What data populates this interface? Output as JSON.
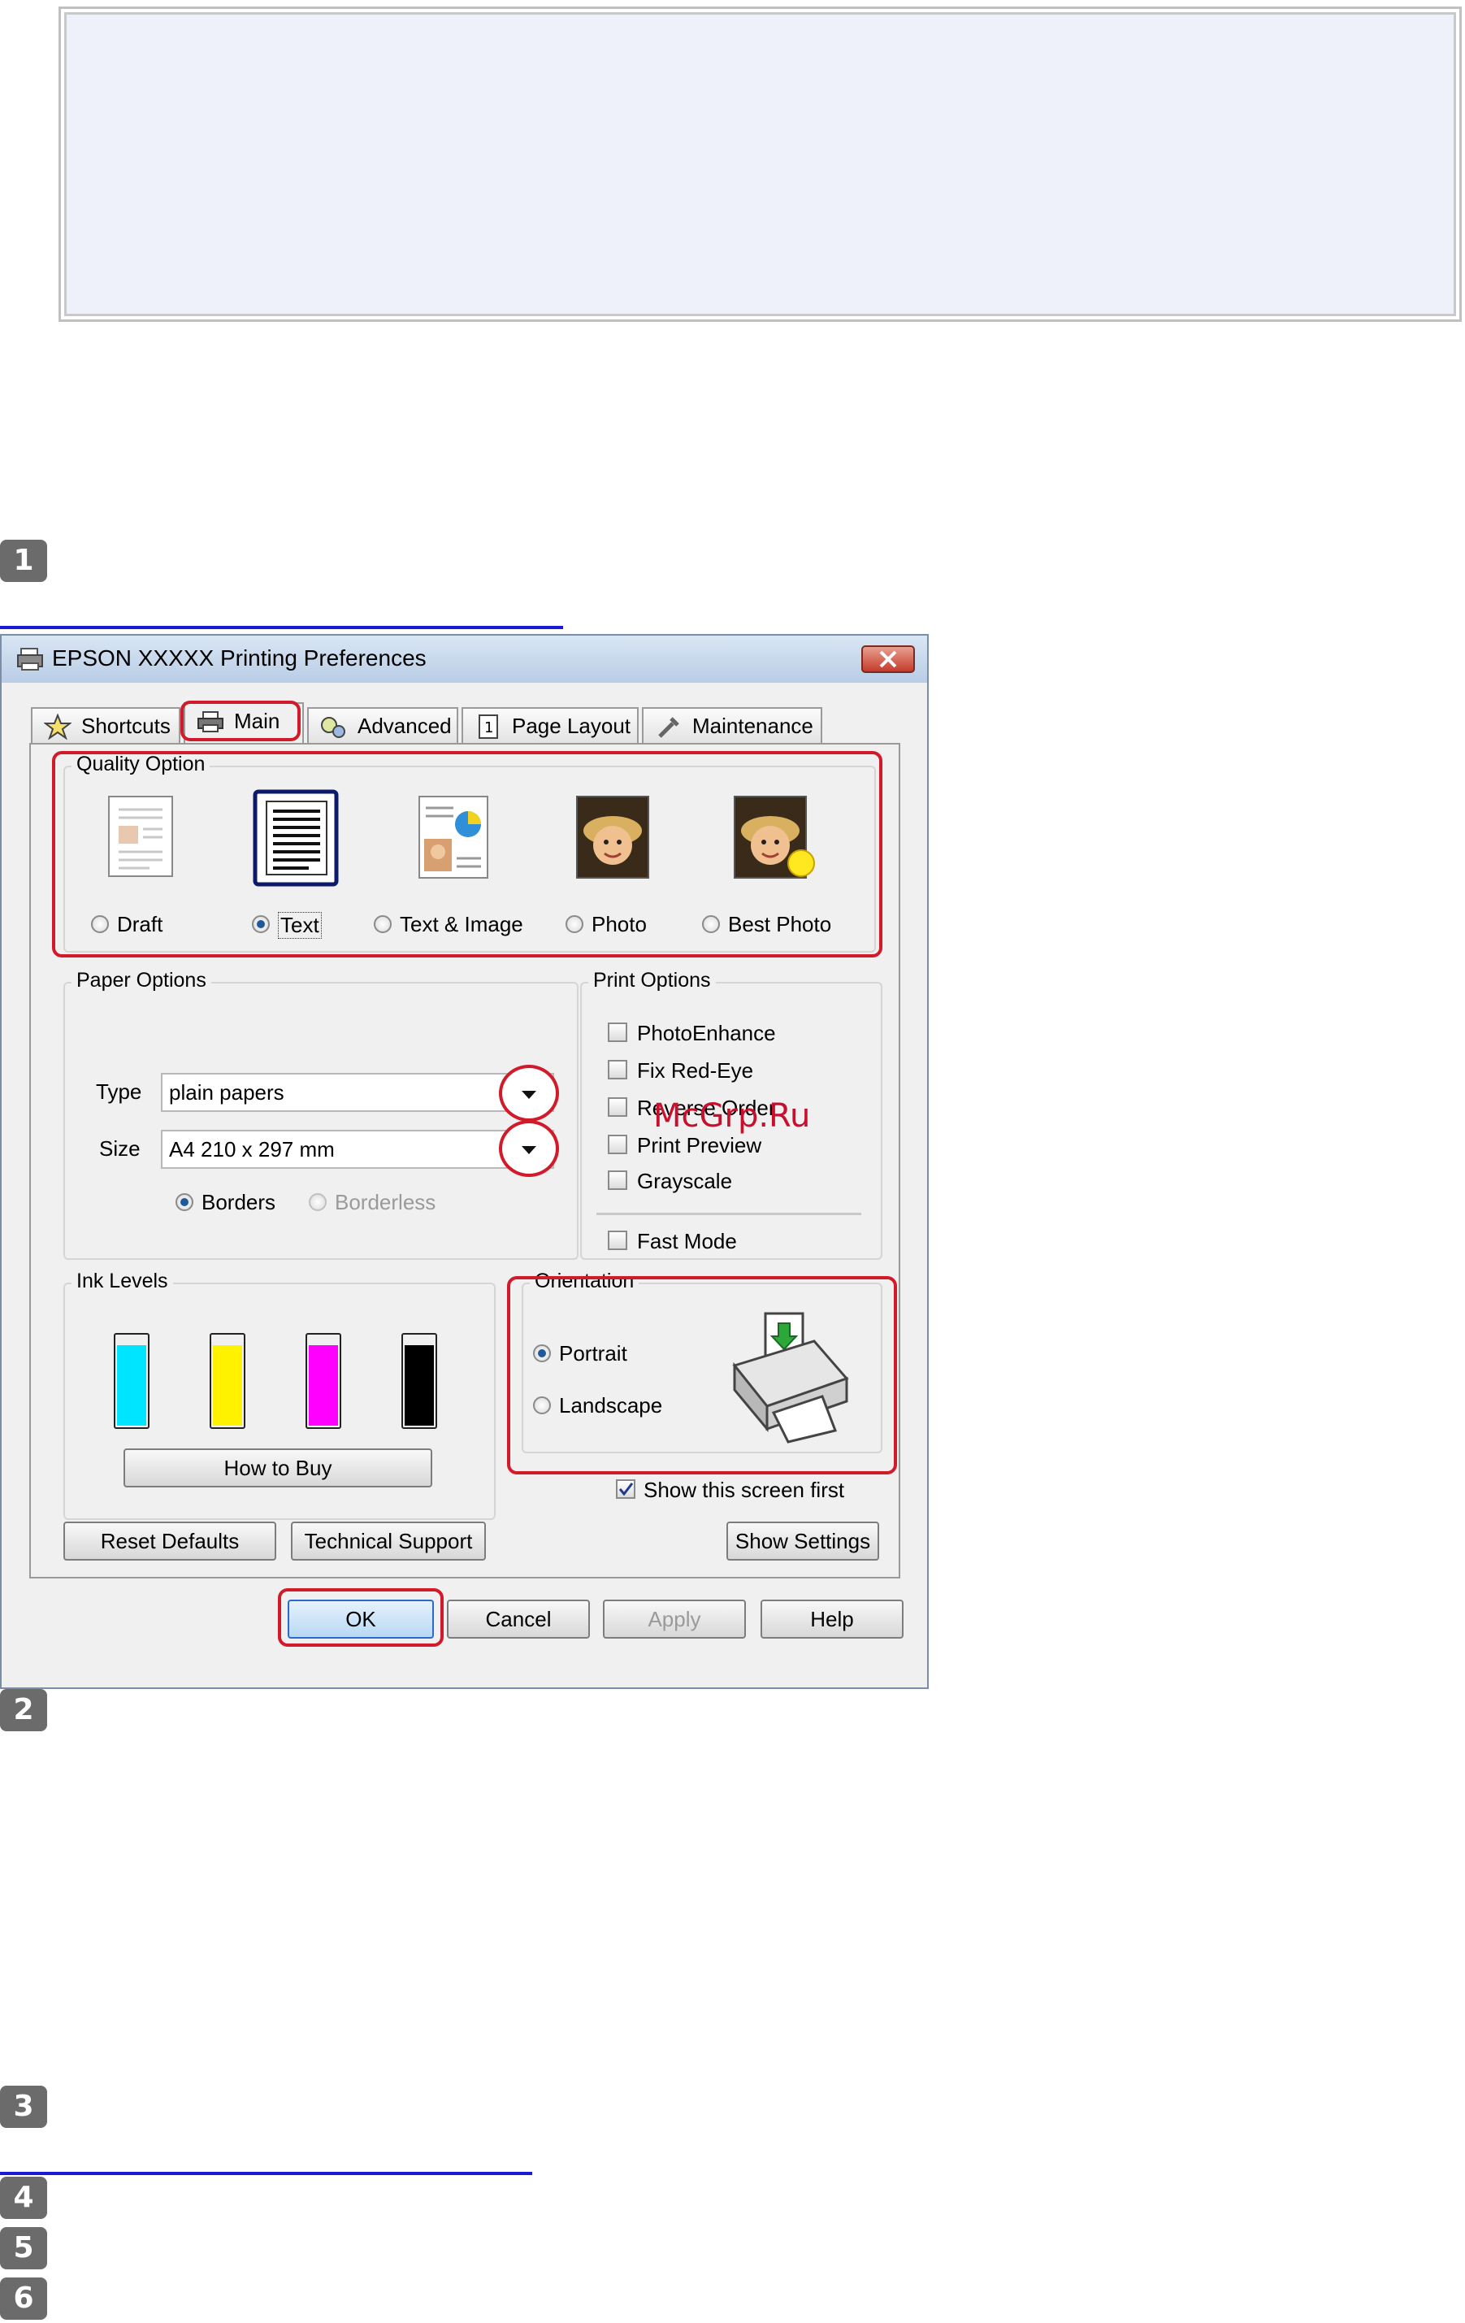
{
  "steps": [
    "1",
    "2",
    "3",
    "4",
    "5",
    "6"
  ],
  "dialog": {
    "title": "EPSON XXXXX  Printing Preferences",
    "tabs": [
      "Shortcuts",
      "Main",
      "Advanced",
      "Page Layout",
      "Maintenance"
    ],
    "active_tab": "Main",
    "quality": {
      "label": "Quality Option",
      "options": [
        "Draft",
        "Text",
        "Text & Image",
        "Photo",
        "Best Photo"
      ],
      "selected": "Text"
    },
    "paper": {
      "label": "Paper Options",
      "type_label": "Type",
      "type_value": "plain papers",
      "size_label": "Size",
      "size_value": "A4 210 x 297 mm",
      "borders": "Borders",
      "borderless": "Borderless"
    },
    "print_options": {
      "label": "Print Options",
      "items": [
        "PhotoEnhance",
        "Fix Red-Eye",
        "Reverse Order",
        "Print Preview",
        "Grayscale"
      ],
      "fast_mode": "Fast Mode"
    },
    "watermark": "McGrp.Ru",
    "ink": {
      "label": "Ink Levels",
      "colors": [
        "#00e5ff",
        "#fff200",
        "#ff00ff",
        "#000000"
      ],
      "levels": [
        0.9,
        0.9,
        0.9,
        0.9
      ],
      "how_to_buy": "How to Buy"
    },
    "orientation": {
      "label": "Orientation",
      "portrait": "Portrait",
      "landscape": "Landscape",
      "selected": "Portrait"
    },
    "show_first": "Show this screen first",
    "buttons": {
      "reset": "Reset Defaults",
      "support": "Technical Support",
      "show_settings": "Show Settings",
      "ok": "OK",
      "cancel": "Cancel",
      "apply": "Apply",
      "help": "Help"
    },
    "highlight_color": "#d11a2a"
  }
}
